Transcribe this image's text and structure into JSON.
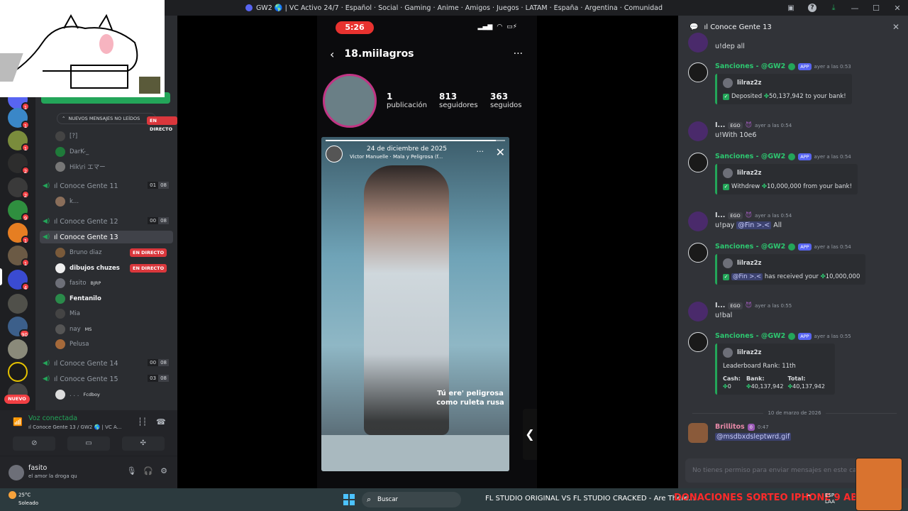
{
  "window": {
    "title": "GW2 🌎 | VC Activo 24/7 · Español · Social · Gaming · Anime · Amigos · Juegos · LATAM · España · Argentina · Comunidad"
  },
  "servers": {
    "badges": [
      "1",
      "1",
      "1",
      "1",
      "2",
      "2",
      "9",
      "1",
      "1",
      "4",
      "90",
      "1",
      "1"
    ],
    "new_label": "NUEVO"
  },
  "channels": {
    "unread_pill": "NUEVOS MENSAJES NO LEÍDOS",
    "live_label": "EN DIRECTO",
    "top_users": [
      "[?]",
      "DarK-_",
      "Hik\\ri エマー"
    ],
    "vc11": {
      "name": "ıl Conoce Gente 11",
      "count": "01",
      "limit": "08",
      "user": "k..."
    },
    "vc12": {
      "name": "ıl Conoce Gente 12",
      "count": "00",
      "limit": "08"
    },
    "vc13": {
      "name": "ıl Conoce Gente 13",
      "users": [
        "Bruno diaz",
        "𝗱𝗶𝗯𝘂𝗷𝗼𝘀 𝗰𝗵𝘂𝘇𝗲𝘀",
        "fasito",
        "Fentanilo",
        "Mia",
        "nay",
        "Pelusa"
      ],
      "tags": [
        "BJRP",
        "MS"
      ]
    },
    "vc14": {
      "name": "ıl Conoce Gente 14",
      "count": "00",
      "limit": "08"
    },
    "vc15": {
      "name": "ıl Conoce Gente 15",
      "count": "03",
      "limit": "08",
      "user": ". . .",
      "user_tag": "Fcdboy"
    }
  },
  "voice": {
    "status": "Voz conectada",
    "channel": "ıl Conoce Gente 13 / GW2 🌎 | VC A..."
  },
  "user": {
    "name": "fasito",
    "status": "el amor la droga qu"
  },
  "stream": {
    "time": "5:26",
    "username": "18.miilagros",
    "stats": [
      {
        "n": "1",
        "l": "publicación"
      },
      {
        "n": "813",
        "l": "seguidores"
      },
      {
        "n": "363",
        "l": "seguidos"
      }
    ],
    "story": {
      "date": "24 de diciembre de 2025",
      "song": "Victor Manuelle · Mala y Peligrosa (f...",
      "caption": "Tú ere' peligrosa como ruleta rusa",
      "progress": 0.95
    }
  },
  "chat": {
    "channel": "ıl Conoce Gente 13",
    "messages": [
      {
        "body": "u!dep all"
      },
      {
        "name": "Sanciones - @GW2",
        "app": "APP",
        "ts": "ayer a las 0:53",
        "embed_user": "lilraz2z",
        "embed_pre": "Deposited",
        "embed_val": "50,137,942",
        "embed_post": "to your bank!"
      },
      {
        "name": "I...",
        "tag": "EGO",
        "ts": "ayer a las 0:54",
        "body": "u!With 10e6"
      },
      {
        "name": "Sanciones - @GW2",
        "app": "APP",
        "ts": "ayer a las 0:54",
        "embed_user": "lilraz2z",
        "embed_pre": "Withdrew",
        "embed_val": "10,000,000",
        "embed_post": "from your bank!"
      },
      {
        "name": "I...",
        "tag": "EGO",
        "ts": "ayer a las 0:54",
        "body_pre": "u!pay",
        "mention": "@Fin >.<",
        "body_post": "All"
      },
      {
        "name": "Sanciones - @GW2",
        "app": "APP",
        "ts": "ayer a las 0:54",
        "embed_user": "lilraz2z",
        "embed_mention": "@Fin >.<",
        "embed_pre": "has received your",
        "embed_val": "10,000,000"
      },
      {
        "name": "I...",
        "tag": "EGO",
        "ts": "ayer a las 0:55",
        "body": "u!bal"
      },
      {
        "name": "Sanciones - @GW2",
        "app": "APP",
        "ts": "ayer a las 0:55",
        "embed_user": "lilraz2z",
        "rank": "Leaderboard Rank: 11th",
        "cols": [
          "Cash:",
          "Bank:",
          "Total:"
        ],
        "vals": [
          "0",
          "40,137,942",
          "40,137,942"
        ]
      }
    ],
    "date_sep": "10 de marzo de 2026",
    "last": {
      "name": "𝗕𝗿𝗶𝗹𝗹𝗶𝘁𝗼𝘀",
      "badge": "0",
      "ts": "0:47",
      "link": "@msdbxdsleptwrd.gif"
    },
    "input_placeholder": "No tienes permiso para enviar mensajes en este ca"
  },
  "taskbar": {
    "temp": "25°C",
    "weather": "Soleado",
    "search": "Buscar",
    "running": "FL STUDIO ORIGINAL VS FL STUDIO CRACKED - Are There...",
    "promo": "DONACIONES SORTEO IPHONE 9 ABR",
    "lang1": "ESP",
    "lang2": "LAA"
  }
}
